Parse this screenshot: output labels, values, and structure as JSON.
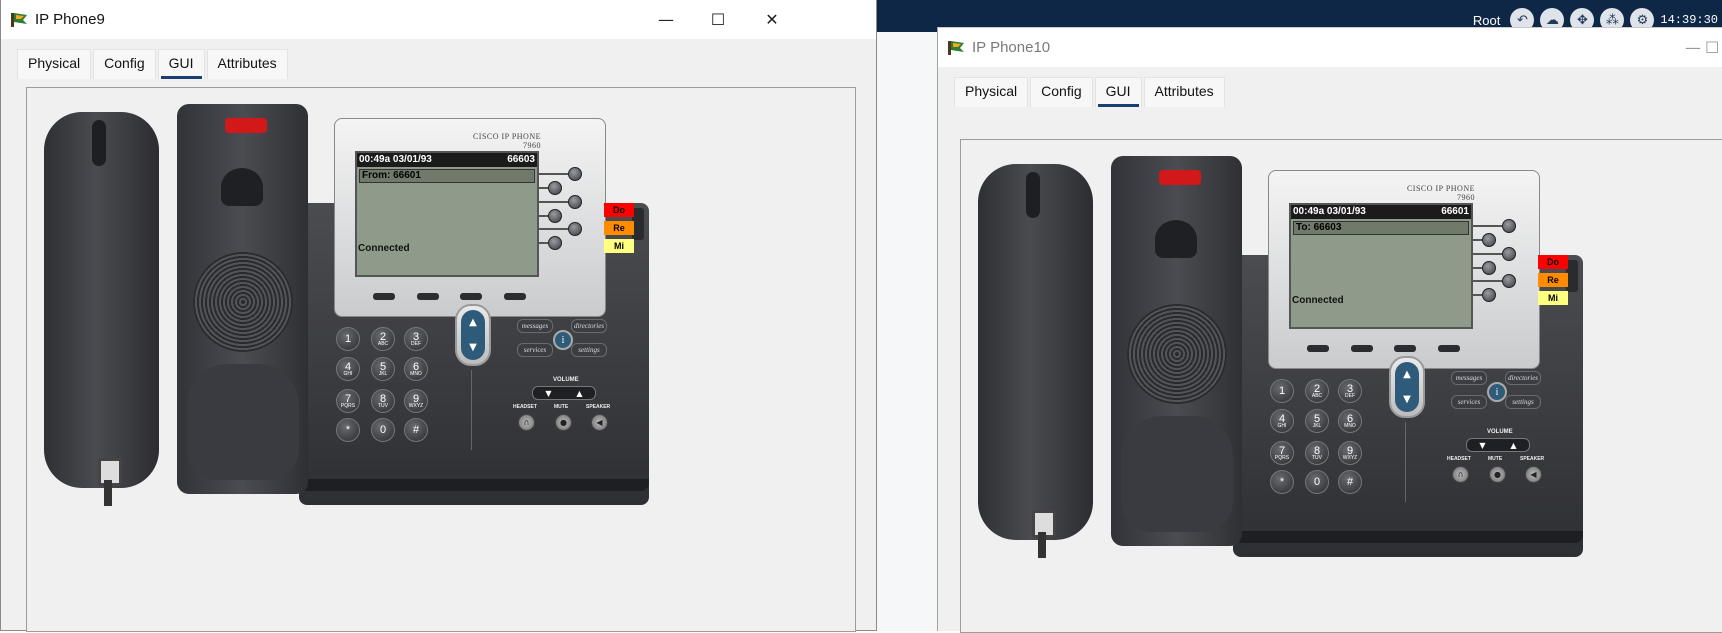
{
  "taskbar": {
    "root_label": "Root",
    "clock": "14:39:30",
    "icons": [
      "back-arrow-icon",
      "cloud-icon",
      "move-icon",
      "network-icon",
      "tools-icon"
    ]
  },
  "windows": [
    {
      "title": "IP Phone9",
      "controls": {
        "minimize": "—",
        "maximize": "☐",
        "close": "✕"
      },
      "tabs": [
        {
          "label": "Physical",
          "active": false
        },
        {
          "label": "Config",
          "active": false
        },
        {
          "label": "GUI",
          "active": true
        },
        {
          "label": "Attributes",
          "active": false
        }
      ],
      "phone": {
        "brand_line1": "CISCO IP PHONE",
        "brand_line2": "7960",
        "lcd": {
          "datetime": "00:49a 03/01/93",
          "extension": "66603",
          "call_line": "From: 66601",
          "status": "Connected"
        },
        "side_buttons": [
          {
            "label": "Do",
            "color": "#ff0000"
          },
          {
            "label": "Re",
            "color": "#ff8c00"
          },
          {
            "label": "Mi",
            "color": "#ffff80"
          }
        ]
      }
    },
    {
      "title": "IP Phone10",
      "controls": {
        "minimize": "—",
        "maximize": "☐"
      },
      "tabs": [
        {
          "label": "Physical",
          "active": false
        },
        {
          "label": "Config",
          "active": false
        },
        {
          "label": "GUI",
          "active": true
        },
        {
          "label": "Attributes",
          "active": false
        }
      ],
      "phone": {
        "brand_line1": "CISCO IP PHONE",
        "brand_line2": "7960",
        "lcd": {
          "datetime": "00:49a 03/01/93",
          "extension": "66601",
          "call_line": "To: 66603",
          "status": "Connected"
        },
        "side_buttons": [
          {
            "label": "Do",
            "color": "#ff0000"
          },
          {
            "label": "Re",
            "color": "#ff8c00"
          },
          {
            "label": "Mi",
            "color": "#ffff80"
          }
        ]
      }
    }
  ],
  "keypad": [
    {
      "n": "1",
      "l": ""
    },
    {
      "n": "2",
      "l": "ABC"
    },
    {
      "n": "3",
      "l": "DEF"
    },
    {
      "n": "4",
      "l": "GHI"
    },
    {
      "n": "5",
      "l": "JKL"
    },
    {
      "n": "6",
      "l": "MNO"
    },
    {
      "n": "7",
      "l": "PQRS"
    },
    {
      "n": "8",
      "l": "TUV"
    },
    {
      "n": "9",
      "l": "WXYZ"
    },
    {
      "n": "*",
      "l": ""
    },
    {
      "n": "0",
      "l": ""
    },
    {
      "n": "#",
      "l": ""
    }
  ],
  "function_keys": {
    "messages": "messages",
    "directories": "directories",
    "services": "services",
    "settings": "settings"
  },
  "volume_label": "VOLUME",
  "audio_labels": {
    "headset": "HEADSET",
    "mute": "MUTE",
    "speaker": "SPEAKER"
  }
}
